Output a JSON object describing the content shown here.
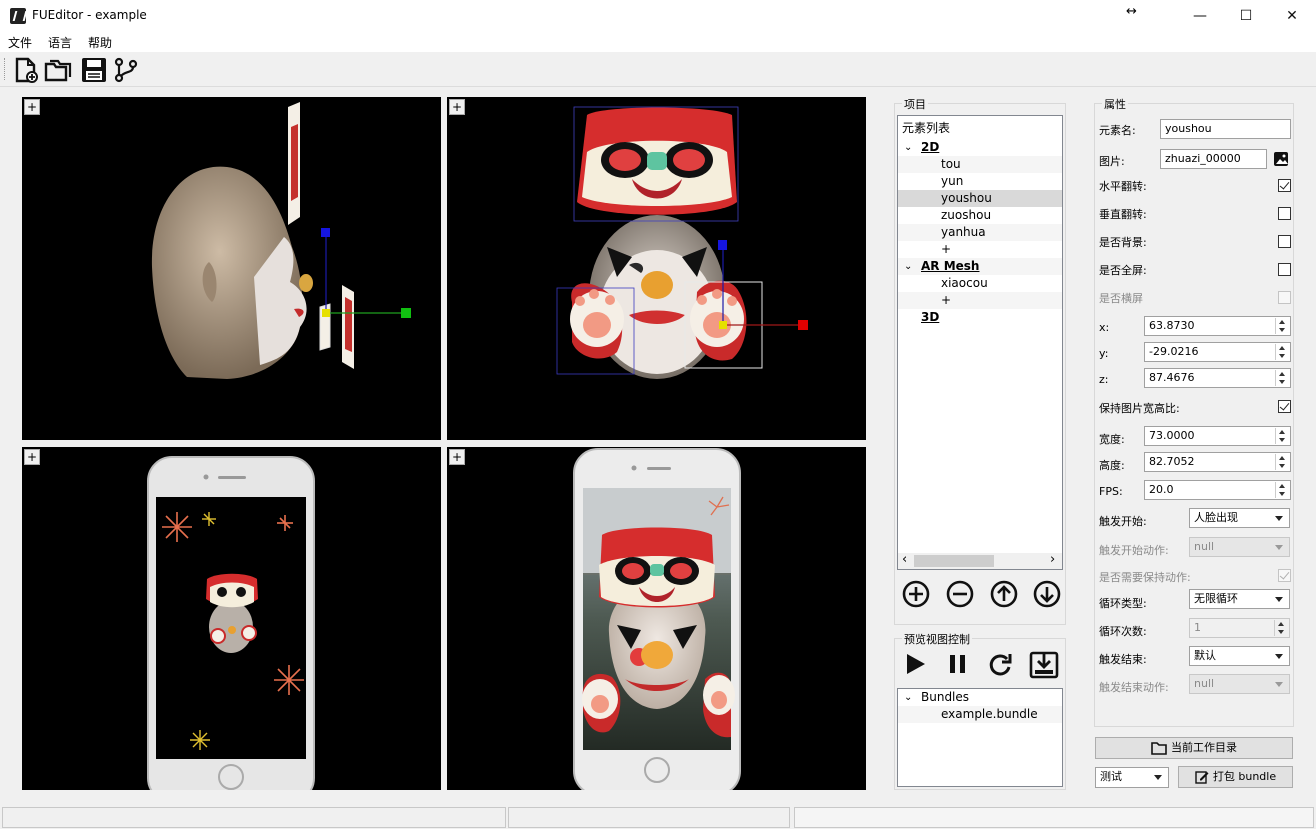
{
  "window": {
    "title": "FUEditor - example",
    "resize_glyph": "↔",
    "minimize": "—",
    "maximize": "☐",
    "close": "✕"
  },
  "menu": [
    "文件",
    "语言",
    "帮助"
  ],
  "toolbar": [
    "new-file-icon",
    "open-folder-icon",
    "save-icon",
    "branch-icon"
  ],
  "viewports": {
    "plus_label": "+"
  },
  "project": {
    "group_title": "项目",
    "list_title": "元素列表",
    "section_2d": "2D",
    "items_2d": [
      "tou",
      "yun",
      "youshou",
      "zuoshou",
      "yanhua",
      "+"
    ],
    "selected": "youshou",
    "section_ar": "AR Mesh",
    "items_ar": [
      "xiaocou",
      "+"
    ],
    "section_3d": "3D",
    "scroll_left": "‹",
    "scroll_right": "›"
  },
  "preview": {
    "group_title": "预览视图控制",
    "bundles_title": "Bundles",
    "bundle_item": "example.bundle"
  },
  "properties": {
    "group_title": "属性",
    "name_label": "元素名:",
    "name_value": "youshou",
    "image_label": "图片:",
    "image_value": "zhuazi_00000",
    "hflip_label": "水平翻转:",
    "hflip": true,
    "vflip_label": "垂直翻转:",
    "vflip": false,
    "bg_label": "是否背景:",
    "bg": false,
    "fullscreen_label": "是否全屏:",
    "fullscreen": false,
    "landscape_label": "是否横屏",
    "landscape": false,
    "x_label": "x:",
    "x_value": "63.8730",
    "y_label": "y:",
    "y_value": "-29.0216",
    "z_label": "z:",
    "z_value": "87.4676",
    "keep_ratio_label": "保持图片宽高比:",
    "keep_ratio": true,
    "width_label": "宽度:",
    "width_value": "73.0000",
    "height_label": "高度:",
    "height_value": "82.7052",
    "fps_label": "FPS:",
    "fps_value": "20.0",
    "trigger_start_label": "触发开始:",
    "trigger_start_value": "人脸出现",
    "trigger_start_action_label": "触发开始动作:",
    "trigger_start_action_value": "null",
    "need_keep_label": "是否需要保持动作:",
    "need_keep": true,
    "loop_type_label": "循环类型:",
    "loop_type_value": "无限循环",
    "loop_count_label": "循环次数:",
    "loop_count_value": "1",
    "trigger_end_label": "触发结束:",
    "trigger_end_value": "默认",
    "trigger_end_action_label": "触发结束动作:",
    "trigger_end_action_value": "null",
    "workdir_button": "当前工作目录",
    "mode_value": "测试",
    "pack_button": "打包 bundle"
  }
}
